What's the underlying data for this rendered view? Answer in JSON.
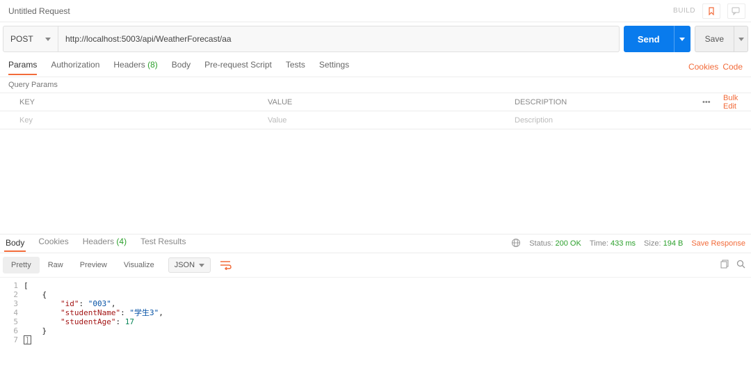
{
  "tab": {
    "title": "Untitled Request",
    "build": "BUILD"
  },
  "request": {
    "method": "POST",
    "url": "http://localhost:5003/api/WeatherForecast/aa",
    "send": "Send",
    "save": "Save"
  },
  "reqTabs": {
    "params": "Params",
    "authorization": "Authorization",
    "headers": "Headers",
    "headersCount": "(8)",
    "body": "Body",
    "prerequest": "Pre-request Script",
    "tests": "Tests",
    "settings": "Settings",
    "cookies": "Cookies",
    "code": "Code"
  },
  "queryParamsLabel": "Query Params",
  "paramsTable": {
    "headers": {
      "key": "KEY",
      "value": "VALUE",
      "description": "DESCRIPTION"
    },
    "more": "•••",
    "bulkEdit": "Bulk Edit",
    "placeholders": {
      "key": "Key",
      "value": "Value",
      "description": "Description"
    }
  },
  "responseTabs": {
    "body": "Body",
    "cookies": "Cookies",
    "headers": "Headers",
    "headersCount": "(4)",
    "testResults": "Test Results"
  },
  "responseMeta": {
    "statusLabel": "Status:",
    "statusValue": "200 OK",
    "timeLabel": "Time:",
    "timeValue": "433 ms",
    "sizeLabel": "Size:",
    "sizeValue": "194 B",
    "saveResponse": "Save Response"
  },
  "viewer": {
    "pretty": "Pretty",
    "raw": "Raw",
    "preview": "Preview",
    "visualize": "Visualize",
    "format": "JSON"
  },
  "responseBody": {
    "lines": [
      "1",
      "2",
      "3",
      "4",
      "5",
      "6",
      "7"
    ],
    "json": {
      "id": "003",
      "studentName": "学生3",
      "studentAge": 17
    }
  }
}
